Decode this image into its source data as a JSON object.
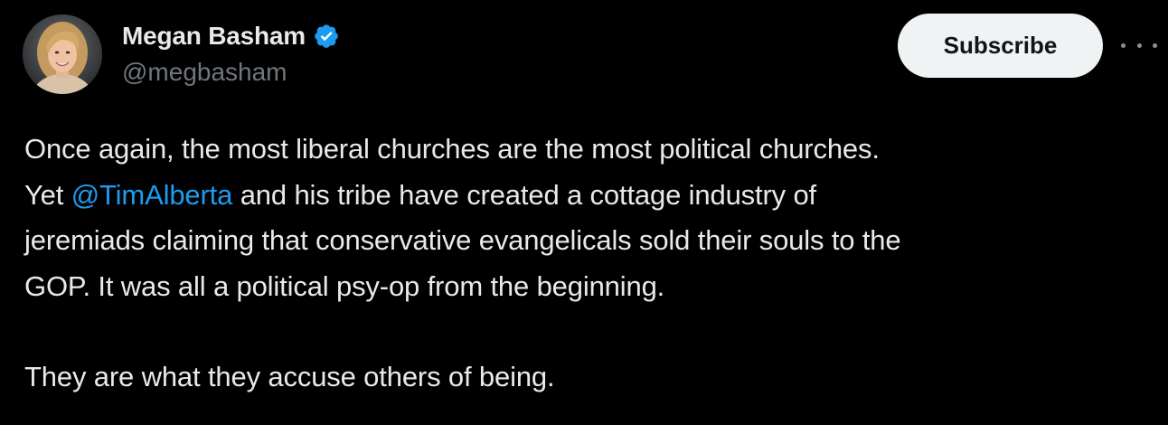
{
  "author": {
    "display_name": "Megan Basham",
    "handle": "@megbasham",
    "verified_icon": "verified-badge-icon",
    "verified_color": "#1d9bf0"
  },
  "actions": {
    "subscribe_label": "Subscribe",
    "more_icon": "more-options-icon"
  },
  "tweet": {
    "line1": "Once again, the most liberal churches are the most political churches.",
    "line2_pre": "Yet ",
    "mention": "@TimAlberta",
    "line2_post": " and his tribe have created a cottage industry of",
    "line3": "jeremiads claiming that conservative evangelicals sold their souls to the",
    "line4": "GOP. It was all a political psy-op from the beginning.",
    "line5": "They are what they accuse others of being."
  },
  "colors": {
    "background": "#000000",
    "text": "#e7e9ea",
    "secondary": "#71767b",
    "link": "#1d9bf0",
    "button_bg": "#eff3f4"
  }
}
